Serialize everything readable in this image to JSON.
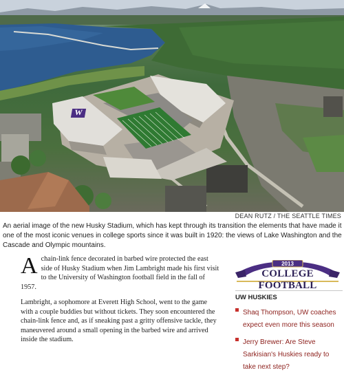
{
  "photo": {
    "credit": "DEAN RUTZ / THE SEATTLE TIMES",
    "stadium_logo_letter": "W"
  },
  "caption": "An aerial image of the new Husky Stadium, which has kept through its transition the elements that have made it one of the most iconic venues in college sports since it was built in 1920: the views of Lake Washington and the Cascade and Olympic mountains.",
  "article": {
    "dropcap": "A",
    "para1_rest": "chain-link fence decorated in barbed wire protected the east side of Husky Stadium when Jim Lambright made his first visit to the University of Washington football field in the fall of 1957.",
    "para2": "Lambright, a sophomore at Everett High School, went to the game with a couple buddies but without tickets. They soon encountered the chain-link fence and, as if sneaking past a gritty offensive tackle, they maneuvered around a small opening in the barbed wire and arrived inside the stadium."
  },
  "sidebar": {
    "banner_year": "2013",
    "banner_title": "COLLEGE FOOTBALL",
    "section_heading": "UW HUSKIES",
    "links": [
      "Shaq Thompson, UW coaches expect even more this season",
      "Jerry Brewer: Are Steve Sarkisian's Huskies ready to take next step?"
    ]
  },
  "colors": {
    "banner_purple": "#4b2e83",
    "banner_gold": "#d8b95a",
    "link_red": "#8c1f1b",
    "bullet_red": "#c7302c",
    "field_green": "#2f7a32"
  }
}
